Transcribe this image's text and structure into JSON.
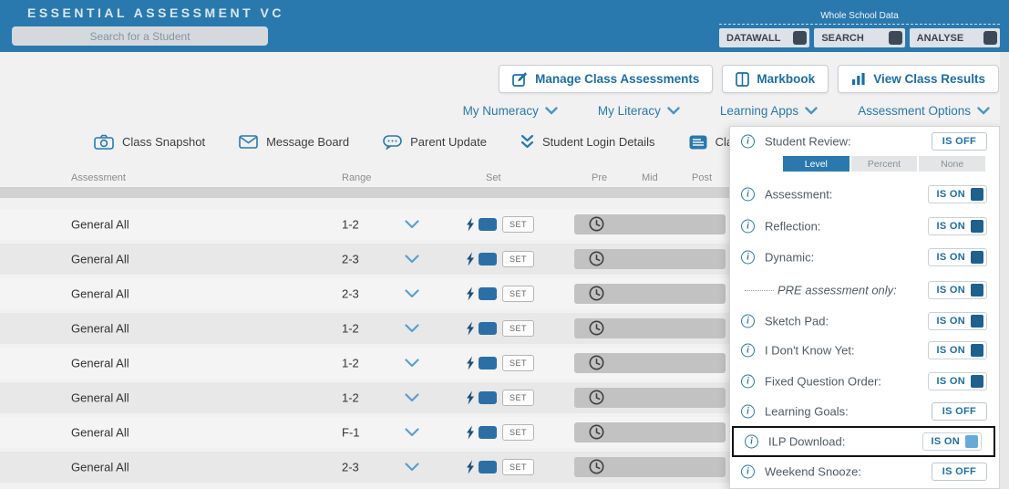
{
  "header": {
    "title": "ESSENTIAL ASSESSMENT VC",
    "search": {
      "placeholder": "Search for a Student"
    },
    "whole_school": {
      "label": "Whole School Data",
      "buttons": [
        {
          "label": "DATAWALL"
        },
        {
          "label": "SEARCH"
        },
        {
          "label": "ANALYSE"
        }
      ]
    }
  },
  "toolbar": {
    "manage": "Manage Class Assessments",
    "markbook": "Markbook",
    "view_results": "View Class Results"
  },
  "menus": {
    "numeracy": "My Numeracy",
    "literacy": "My Literacy",
    "apps": "Learning Apps",
    "options": "Assessment Options"
  },
  "quick_links": {
    "snapshot": "Class Snapshot",
    "message_board": "Message Board",
    "parent_update": "Parent Update",
    "login_details": "Student Login Details",
    "class_profile": "Class Profile"
  },
  "table": {
    "headers": [
      "Assessment",
      "Range",
      "Set",
      "Pre",
      "Mid",
      "Post"
    ],
    "set_label": "SET",
    "rows": [
      {
        "assessment": "General All",
        "range": "1-2"
      },
      {
        "assessment": "General All",
        "range": "2-3"
      },
      {
        "assessment": "General All",
        "range": "2-3"
      },
      {
        "assessment": "General All",
        "range": "1-2"
      },
      {
        "assessment": "General All",
        "range": "1-2"
      },
      {
        "assessment": "General All",
        "range": "1-2"
      },
      {
        "assessment": "General All",
        "range": "F-1"
      },
      {
        "assessment": "General All",
        "range": "2-3"
      }
    ]
  },
  "options_panel": {
    "info_glyph": "i",
    "segmented": {
      "options": [
        "Level",
        "Percent",
        "None"
      ],
      "active": "Level"
    },
    "items": [
      {
        "label": "Student Review:",
        "state": "IS OFF"
      },
      {
        "label": "Assessment:",
        "state": "IS ON"
      },
      {
        "label": "Reflection:",
        "state": "IS ON"
      },
      {
        "label": "Dynamic:",
        "state": "IS ON"
      },
      {
        "label": "PRE assessment only:",
        "state": "IS ON"
      },
      {
        "label": "Sketch Pad:",
        "state": "IS ON"
      },
      {
        "label": "I Don't Know Yet:",
        "state": "IS ON"
      },
      {
        "label": "Fixed Question Order:",
        "state": "IS ON"
      },
      {
        "label": "Learning Goals:",
        "state": "IS OFF"
      },
      {
        "label": "ILP Download:",
        "state": "IS ON"
      },
      {
        "label": "Weekend Snooze:",
        "state": "IS OFF"
      }
    ]
  },
  "colors": {
    "header_blue": "#2a79ae",
    "accent_blue": "#1c6ea4",
    "toggle_dark": "#3d4a55",
    "toggle_blue": "#2b6fa6",
    "toggle_on": "#1f608f",
    "toggle_highlight": "#67aad9"
  }
}
